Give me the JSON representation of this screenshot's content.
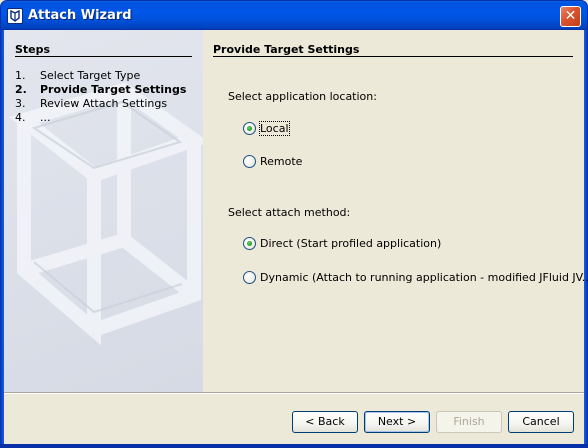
{
  "window": {
    "title": "Attach Wizard",
    "close_glyph": "✕",
    "app_icon": "app-icon"
  },
  "steps": {
    "heading": "Steps",
    "items": [
      {
        "num": "1.",
        "label": "Select Target Type",
        "current": false
      },
      {
        "num": "2.",
        "label": "Provide Target Settings",
        "current": true
      },
      {
        "num": "3.",
        "label": "Review Attach Settings",
        "current": false
      },
      {
        "num": "4.",
        "label": "...",
        "current": false
      }
    ]
  },
  "content": {
    "heading": "Provide Target Settings",
    "location_label": "Select application location:",
    "location_options": [
      {
        "label": "Local",
        "checked": true,
        "focused": true
      },
      {
        "label": "Remote",
        "checked": false,
        "focused": false
      }
    ],
    "method_label": "Select attach method:",
    "method_options": [
      {
        "label": "Direct (Start profiled application)",
        "checked": true
      },
      {
        "label": "Dynamic (Attach to running application - modified JFluid JV...",
        "checked": false
      }
    ]
  },
  "buttons": {
    "back": "< Back",
    "next": "Next >",
    "finish": "Finish",
    "cancel": "Cancel"
  },
  "colors": {
    "title_bar": "#0054e3",
    "dialog_bg": "#ece9d8",
    "radio_dot": "#21a121"
  }
}
